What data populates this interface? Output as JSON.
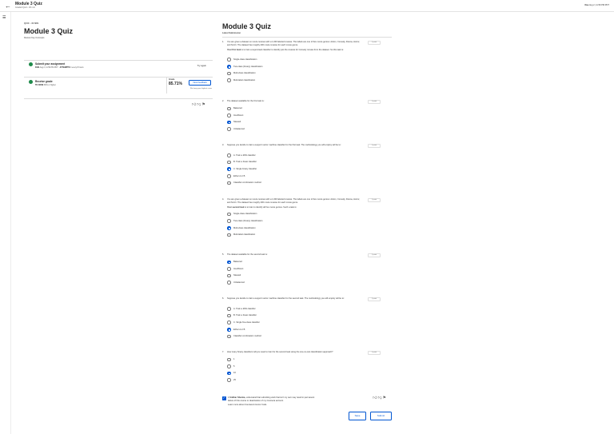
{
  "header": {
    "title": "Module 3 Quiz",
    "subtitle": "Graded Quiz • 30 min",
    "due_label": "Due",
    "due_value": "Aug 2, 11:59 PM PDT"
  },
  "left": {
    "kicker": "QUIZ • 30 MIN",
    "title": "Module 3 Quiz",
    "subtitle": "Review Key Concepts",
    "submit": {
      "label": "Submit your assignment",
      "due_label": "DUE",
      "due_value": "Aug 2, 11:59 PM PDT",
      "attempts_label": "ATTEMPTS",
      "attempts_value": "3 every 8 hours",
      "try_again": "Try again"
    },
    "grade": {
      "label": "Receive grade",
      "to_pass_label": "TO PASS",
      "to_pass_value": "80% or higher",
      "your_grade_label": "Grade",
      "your_grade_value": "85.71%",
      "view_feedback": "View Feedback",
      "keep_note": "We keep your highest score"
    }
  },
  "right": {
    "title": "Module 3 Quiz",
    "subtitle": "Latest Submission"
  },
  "questions": [
    {
      "num": "1.",
      "text": "You are given a dataset on movie reviews with a 1,000 labeled reviews. The labels are one of five movie genres: Action, Comedy, Drama, Horror, and Sci-Fi. The dataset has roughly 200 movie reviews for each movie genre.",
      "note_bold": "Your first task",
      "note": " is to train a supervised classifier to identify just the reviews for Comedy movies from the dataset. So this task is:",
      "points": "1 point",
      "options": [
        "Single-class classification",
        "Two-class (binary) classification",
        "Multi-class classification",
        "Multi-label classification"
      ],
      "selected": 1
    },
    {
      "num": "2.",
      "text": "The dataset available for the first task is:",
      "points": "1 point",
      "options": [
        "Balanced",
        "Insufficient",
        "Skewed",
        "Unbalanced"
      ],
      "selected": 2
    },
    {
      "num": "3.",
      "text": "Suppose you decide to train a support vector machine classifier for the first task. The methodology you will employ will be to:",
      "points": "1 point",
      "options": [
        "A. Train a kNN classifier",
        "B. Train a linear classifier",
        "C. Single binary classifier",
        "Either A or B",
        "Classifier combination method"
      ],
      "selected": 2
    },
    {
      "num": "4.",
      "text": "You are given a dataset on movie reviews with a 1,000 labeled reviews. The labels are one of five movie genres: Action, Comedy, Drama, Horror, and Sci-Fi. The dataset has roughly 200 movie reviews for each movie genre.",
      "note_bold": "Your second task",
      "note": " is to train to identify all five movie genres. Such a task is:",
      "points": "1 point",
      "options": [
        "Single-class classification",
        "Two-class (binary) classification",
        "Multi-class classification",
        "Multi-label classification"
      ],
      "selected": 2
    },
    {
      "num": "5.",
      "text": "The dataset available for the second task is:",
      "points": "1 point",
      "options": [
        "Balanced",
        "Insufficient",
        "Skewed",
        "Unbalanced"
      ],
      "selected": 0
    },
    {
      "num": "6.",
      "text": "Suppose you decide to train a support vector machine classifier for the second task. The methodology you will employ will be to:",
      "points": "1 point",
      "options": [
        "A. Train a kNN classifier",
        "B. Train a linear classifier",
        "C. Single five-class classifier",
        "Either A or B",
        "Classifier combination method"
      ],
      "selected": 3
    },
    {
      "num": "7.",
      "text": "How many binary classifiers will you need to train for the second task using the one-vs-rest classification approach?",
      "points": "1 point",
      "options": [
        "1",
        "5",
        "10",
        "25"
      ],
      "selected": 2
    }
  ],
  "honor": {
    "name": "I, Sridhar Sharma,",
    "text": " understand that submitting work that isn't my own may result in permanent",
    "line2": "failure of this course or deactivation of my Coursera account.",
    "line3": "Learn more about Coursera's Honor Code"
  },
  "actions": {
    "save": "Save",
    "submit": "Submit"
  }
}
